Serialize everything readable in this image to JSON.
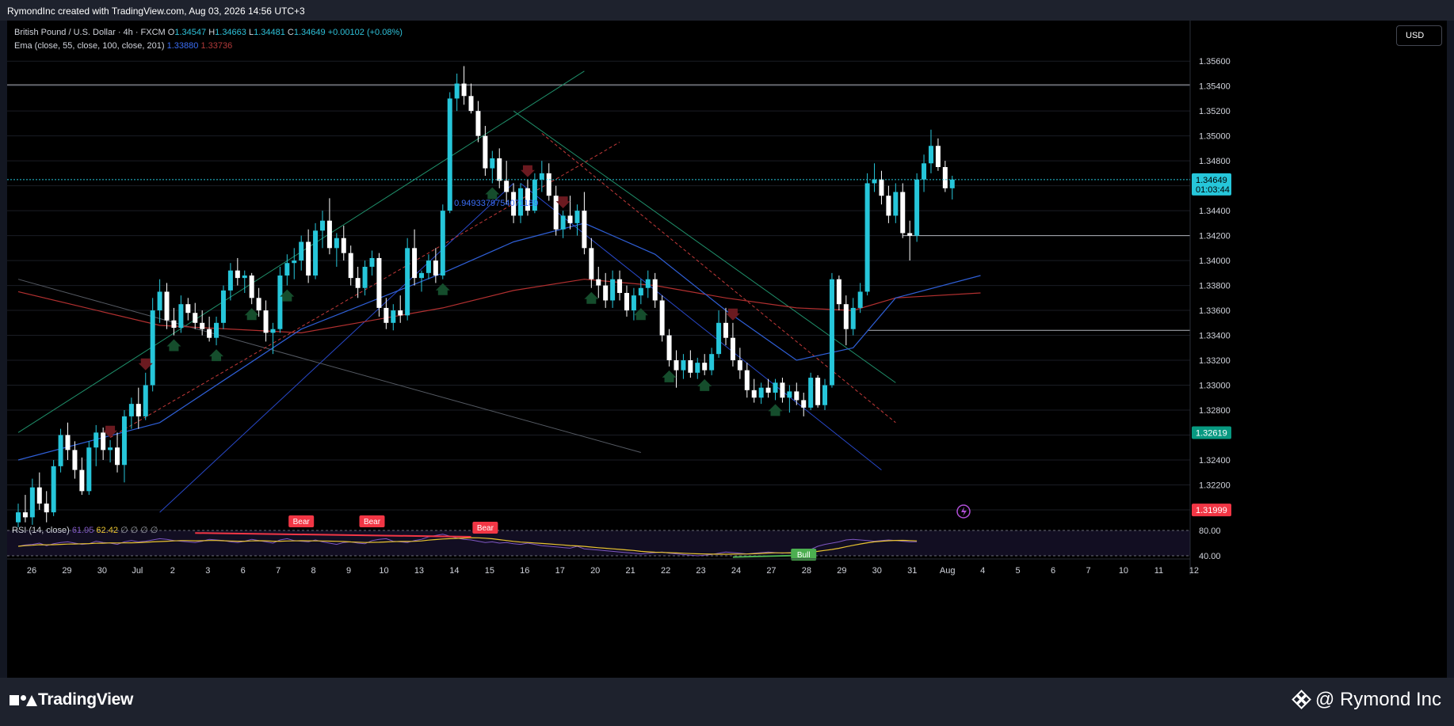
{
  "header": {
    "credit": "RymondInc created with TradingView.com, Aug 03, 2026 14:56 UTC+3"
  },
  "legend": {
    "symbol": "British Pound / U.S. Dollar · 4h · FXCM",
    "open_label": "O",
    "open": "1.34547",
    "high_label": "H",
    "high": "1.34663",
    "low_label": "L",
    "low": "1.34481",
    "close_label": "C",
    "close": "1.34649",
    "change": "+0.00102 (+0.08%)",
    "ema_label": "Ema (close, 55, close, 100, close, 201)",
    "ema_val1": "1.33880",
    "ema_val2": "1.33736"
  },
  "currency": "USD",
  "annotation_fib": "0.9493379754071189",
  "rsi_label": "RSI (14, close)",
  "rsi_val1": "61.95",
  "rsi_val2": "62.42",
  "rsi_zeros": "∅ ∅ ∅ ∅",
  "rsi_ticks": [
    "80.00",
    "40.00"
  ],
  "footer": {
    "brand": "TradingView",
    "watermark": "@ Rymond Inc"
  },
  "colors": {
    "up": "#26c6da",
    "down": "#ffffff",
    "ema_blue": "#2f5fd6",
    "ema_red": "#b23030",
    "current_badge": "#26c6da",
    "green_badge": "#089981",
    "red_badge": "#f23645",
    "bear_label": "#f23645",
    "bull_label": "#4caf50"
  },
  "chart_data": {
    "type": "candlestick",
    "symbol": "GBPUSD",
    "timeframe": "4h",
    "y_ticks": [
      "1.35600",
      "1.35400",
      "1.35200",
      "1.35000",
      "1.34800",
      "1.34600",
      "1.34400",
      "1.34200",
      "1.34000",
      "1.33800",
      "1.33600",
      "1.33400",
      "1.33200",
      "1.33000",
      "1.32800",
      "1.32600",
      "1.32400",
      "1.32200",
      "1.32000"
    ],
    "ylim": [
      1.3186,
      1.3576
    ],
    "x_ticks": [
      "26",
      "29",
      "30",
      "Jul",
      "2",
      "3",
      "6",
      "7",
      "8",
      "9",
      "10",
      "13",
      "14",
      "15",
      "16",
      "17",
      "20",
      "21",
      "22",
      "23",
      "24",
      "27",
      "28",
      "29",
      "30",
      "31",
      "Aug",
      "4",
      "5",
      "6",
      "7",
      "10",
      "11",
      "12"
    ],
    "price_badges": [
      {
        "value": "1.34649",
        "sub": "01:03:44",
        "price": 1.34649,
        "kind": "current"
      },
      {
        "value": "1.32619",
        "price": 1.32619,
        "kind": "green"
      },
      {
        "value": "1.31999",
        "price": 1.31999,
        "kind": "red"
      }
    ],
    "horizontal_levels": [
      1.3541,
      1.342,
      1.3344
    ],
    "candles": [
      {
        "o": 1.319,
        "h": 1.3205,
        "l": 1.3186,
        "c": 1.3198
      },
      {
        "o": 1.3198,
        "h": 1.3212,
        "l": 1.319,
        "c": 1.3194
      },
      {
        "o": 1.3194,
        "h": 1.3225,
        "l": 1.3188,
        "c": 1.3218
      },
      {
        "o": 1.3218,
        "h": 1.323,
        "l": 1.32,
        "c": 1.3205
      },
      {
        "o": 1.3205,
        "h": 1.3215,
        "l": 1.319,
        "c": 1.3198
      },
      {
        "o": 1.3198,
        "h": 1.324,
        "l": 1.3195,
        "c": 1.3235
      },
      {
        "o": 1.3235,
        "h": 1.3265,
        "l": 1.323,
        "c": 1.326
      },
      {
        "o": 1.326,
        "h": 1.327,
        "l": 1.324,
        "c": 1.3248
      },
      {
        "o": 1.3248,
        "h": 1.3255,
        "l": 1.3225,
        "c": 1.3232
      },
      {
        "o": 1.3232,
        "h": 1.3242,
        "l": 1.3212,
        "c": 1.3215
      },
      {
        "o": 1.3215,
        "h": 1.3255,
        "l": 1.3212,
        "c": 1.325
      },
      {
        "o": 1.325,
        "h": 1.3268,
        "l": 1.3235,
        "c": 1.3262
      },
      {
        "o": 1.3262,
        "h": 1.3266,
        "l": 1.324,
        "c": 1.3248
      },
      {
        "o": 1.3248,
        "h": 1.3256,
        "l": 1.3238,
        "c": 1.325
      },
      {
        "o": 1.325,
        "h": 1.3262,
        "l": 1.323,
        "c": 1.3236
      },
      {
        "o": 1.3236,
        "h": 1.328,
        "l": 1.3222,
        "c": 1.3275
      },
      {
        "o": 1.3275,
        "h": 1.329,
        "l": 1.3265,
        "c": 1.3285
      },
      {
        "o": 1.3285,
        "h": 1.3298,
        "l": 1.3265,
        "c": 1.3275
      },
      {
        "o": 1.3275,
        "h": 1.331,
        "l": 1.3272,
        "c": 1.33
      },
      {
        "o": 1.33,
        "h": 1.337,
        "l": 1.3295,
        "c": 1.336
      },
      {
        "o": 1.336,
        "h": 1.3385,
        "l": 1.335,
        "c": 1.3375
      },
      {
        "o": 1.3375,
        "h": 1.3382,
        "l": 1.3345,
        "c": 1.3352
      },
      {
        "o": 1.3352,
        "h": 1.3362,
        "l": 1.334,
        "c": 1.3346
      },
      {
        "o": 1.3346,
        "h": 1.3372,
        "l": 1.3342,
        "c": 1.3365
      },
      {
        "o": 1.3365,
        "h": 1.337,
        "l": 1.3352,
        "c": 1.3358
      },
      {
        "o": 1.3358,
        "h": 1.3366,
        "l": 1.3345,
        "c": 1.335
      },
      {
        "o": 1.335,
        "h": 1.336,
        "l": 1.334,
        "c": 1.3345
      },
      {
        "o": 1.3345,
        "h": 1.3355,
        "l": 1.3335,
        "c": 1.3338
      },
      {
        "o": 1.3338,
        "h": 1.3355,
        "l": 1.3332,
        "c": 1.335
      },
      {
        "o": 1.335,
        "h": 1.338,
        "l": 1.3345,
        "c": 1.3376
      },
      {
        "o": 1.3376,
        "h": 1.3398,
        "l": 1.3368,
        "c": 1.3392
      },
      {
        "o": 1.3392,
        "h": 1.3402,
        "l": 1.338,
        "c": 1.3386
      },
      {
        "o": 1.3386,
        "h": 1.3392,
        "l": 1.3374,
        "c": 1.3388
      },
      {
        "o": 1.3388,
        "h": 1.339,
        "l": 1.3365,
        "c": 1.337
      },
      {
        "o": 1.337,
        "h": 1.3378,
        "l": 1.3355,
        "c": 1.336
      },
      {
        "o": 1.336,
        "h": 1.3368,
        "l": 1.3335,
        "c": 1.3342
      },
      {
        "o": 1.3342,
        "h": 1.335,
        "l": 1.3325,
        "c": 1.3345
      },
      {
        "o": 1.3345,
        "h": 1.3395,
        "l": 1.3342,
        "c": 1.3388
      },
      {
        "o": 1.3388,
        "h": 1.3405,
        "l": 1.338,
        "c": 1.3398
      },
      {
        "o": 1.3398,
        "h": 1.341,
        "l": 1.3385,
        "c": 1.34
      },
      {
        "o": 1.34,
        "h": 1.342,
        "l": 1.3392,
        "c": 1.3415
      },
      {
        "o": 1.3415,
        "h": 1.3425,
        "l": 1.3382,
        "c": 1.3388
      },
      {
        "o": 1.3388,
        "h": 1.343,
        "l": 1.3385,
        "c": 1.3424
      },
      {
        "o": 1.3424,
        "h": 1.344,
        "l": 1.341,
        "c": 1.3432
      },
      {
        "o": 1.3432,
        "h": 1.345,
        "l": 1.3405,
        "c": 1.341
      },
      {
        "o": 1.341,
        "h": 1.3422,
        "l": 1.3395,
        "c": 1.3418
      },
      {
        "o": 1.3418,
        "h": 1.3428,
        "l": 1.34,
        "c": 1.3406
      },
      {
        "o": 1.3406,
        "h": 1.3412,
        "l": 1.338,
        "c": 1.3386
      },
      {
        "o": 1.3386,
        "h": 1.3395,
        "l": 1.337,
        "c": 1.3378
      },
      {
        "o": 1.3378,
        "h": 1.34,
        "l": 1.3372,
        "c": 1.3395
      },
      {
        "o": 1.3395,
        "h": 1.3408,
        "l": 1.3388,
        "c": 1.3402
      },
      {
        "o": 1.3402,
        "h": 1.3406,
        "l": 1.3355,
        "c": 1.3362
      },
      {
        "o": 1.3362,
        "h": 1.337,
        "l": 1.3345,
        "c": 1.335
      },
      {
        "o": 1.335,
        "h": 1.3365,
        "l": 1.3344,
        "c": 1.336
      },
      {
        "o": 1.336,
        "h": 1.3372,
        "l": 1.335,
        "c": 1.3356
      },
      {
        "o": 1.3356,
        "h": 1.3418,
        "l": 1.3352,
        "c": 1.341
      },
      {
        "o": 1.341,
        "h": 1.3425,
        "l": 1.338,
        "c": 1.3386
      },
      {
        "o": 1.3386,
        "h": 1.3392,
        "l": 1.3375,
        "c": 1.339
      },
      {
        "o": 1.339,
        "h": 1.3405,
        "l": 1.3385,
        "c": 1.34
      },
      {
        "o": 1.34,
        "h": 1.341,
        "l": 1.3382,
        "c": 1.3388
      },
      {
        "o": 1.3388,
        "h": 1.3445,
        "l": 1.3385,
        "c": 1.344
      },
      {
        "o": 1.344,
        "h": 1.3535,
        "l": 1.3438,
        "c": 1.353
      },
      {
        "o": 1.353,
        "h": 1.355,
        "l": 1.352,
        "c": 1.3542
      },
      {
        "o": 1.3542,
        "h": 1.3556,
        "l": 1.3525,
        "c": 1.3532
      },
      {
        "o": 1.3532,
        "h": 1.3542,
        "l": 1.3518,
        "c": 1.352
      },
      {
        "o": 1.352,
        "h": 1.3528,
        "l": 1.3495,
        "c": 1.35
      },
      {
        "o": 1.35,
        "h": 1.3508,
        "l": 1.3468,
        "c": 1.3474
      },
      {
        "o": 1.3474,
        "h": 1.3488,
        "l": 1.3462,
        "c": 1.3482
      },
      {
        "o": 1.3482,
        "h": 1.349,
        "l": 1.3458,
        "c": 1.3464
      },
      {
        "o": 1.3464,
        "h": 1.348,
        "l": 1.3445,
        "c": 1.3455
      },
      {
        "o": 1.3455,
        "h": 1.3462,
        "l": 1.343,
        "c": 1.3436
      },
      {
        "o": 1.3436,
        "h": 1.3462,
        "l": 1.343,
        "c": 1.3458
      },
      {
        "o": 1.3458,
        "h": 1.3465,
        "l": 1.3436,
        "c": 1.344
      },
      {
        "o": 1.344,
        "h": 1.347,
        "l": 1.3438,
        "c": 1.3465
      },
      {
        "o": 1.3465,
        "h": 1.348,
        "l": 1.3455,
        "c": 1.347
      },
      {
        "o": 1.347,
        "h": 1.3478,
        "l": 1.3448,
        "c": 1.3452
      },
      {
        "o": 1.3452,
        "h": 1.346,
        "l": 1.342,
        "c": 1.3425
      },
      {
        "o": 1.3425,
        "h": 1.344,
        "l": 1.3418,
        "c": 1.3436
      },
      {
        "o": 1.3436,
        "h": 1.3452,
        "l": 1.3425,
        "c": 1.343
      },
      {
        "o": 1.343,
        "h": 1.3445,
        "l": 1.342,
        "c": 1.344
      },
      {
        "o": 1.344,
        "h": 1.3455,
        "l": 1.3405,
        "c": 1.341
      },
      {
        "o": 1.341,
        "h": 1.3418,
        "l": 1.3378,
        "c": 1.3385
      },
      {
        "o": 1.3385,
        "h": 1.3395,
        "l": 1.337,
        "c": 1.338
      },
      {
        "o": 1.338,
        "h": 1.339,
        "l": 1.3362,
        "c": 1.3368
      },
      {
        "o": 1.3368,
        "h": 1.3392,
        "l": 1.3362,
        "c": 1.3385
      },
      {
        "o": 1.3385,
        "h": 1.3392,
        "l": 1.3368,
        "c": 1.3374
      },
      {
        "o": 1.3374,
        "h": 1.338,
        "l": 1.3355,
        "c": 1.336
      },
      {
        "o": 1.336,
        "h": 1.3378,
        "l": 1.3352,
        "c": 1.3372
      },
      {
        "o": 1.3372,
        "h": 1.3385,
        "l": 1.3365,
        "c": 1.3378
      },
      {
        "o": 1.3378,
        "h": 1.3392,
        "l": 1.337,
        "c": 1.3385
      },
      {
        "o": 1.3385,
        "h": 1.339,
        "l": 1.3362,
        "c": 1.3368
      },
      {
        "o": 1.3368,
        "h": 1.3372,
        "l": 1.3335,
        "c": 1.334
      },
      {
        "o": 1.334,
        "h": 1.3345,
        "l": 1.3315,
        "c": 1.332
      },
      {
        "o": 1.332,
        "h": 1.3328,
        "l": 1.3298,
        "c": 1.3312
      },
      {
        "o": 1.3312,
        "h": 1.3325,
        "l": 1.3305,
        "c": 1.332
      },
      {
        "o": 1.332,
        "h": 1.3328,
        "l": 1.3306,
        "c": 1.331
      },
      {
        "o": 1.331,
        "h": 1.3322,
        "l": 1.3305,
        "c": 1.3318
      },
      {
        "o": 1.3318,
        "h": 1.3325,
        "l": 1.3308,
        "c": 1.3312
      },
      {
        "o": 1.3312,
        "h": 1.333,
        "l": 1.3308,
        "c": 1.3325
      },
      {
        "o": 1.3325,
        "h": 1.336,
        "l": 1.3322,
        "c": 1.335
      },
      {
        "o": 1.335,
        "h": 1.3362,
        "l": 1.3332,
        "c": 1.3338
      },
      {
        "o": 1.3338,
        "h": 1.335,
        "l": 1.3315,
        "c": 1.332
      },
      {
        "o": 1.332,
        "h": 1.333,
        "l": 1.3305,
        "c": 1.3312
      },
      {
        "o": 1.3312,
        "h": 1.3318,
        "l": 1.329,
        "c": 1.3296
      },
      {
        "o": 1.3296,
        "h": 1.3305,
        "l": 1.3286,
        "c": 1.329
      },
      {
        "o": 1.329,
        "h": 1.3302,
        "l": 1.3285,
        "c": 1.3298
      },
      {
        "o": 1.3298,
        "h": 1.3305,
        "l": 1.329,
        "c": 1.3294
      },
      {
        "o": 1.3294,
        "h": 1.3305,
        "l": 1.3288,
        "c": 1.3302
      },
      {
        "o": 1.3302,
        "h": 1.3306,
        "l": 1.3286,
        "c": 1.329
      },
      {
        "o": 1.329,
        "h": 1.33,
        "l": 1.3278,
        "c": 1.3295
      },
      {
        "o": 1.3295,
        "h": 1.3302,
        "l": 1.3284,
        "c": 1.3288
      },
      {
        "o": 1.3288,
        "h": 1.3294,
        "l": 1.3275,
        "c": 1.3282
      },
      {
        "o": 1.3282,
        "h": 1.331,
        "l": 1.328,
        "c": 1.3306
      },
      {
        "o": 1.3306,
        "h": 1.3308,
        "l": 1.3282,
        "c": 1.3284
      },
      {
        "o": 1.3284,
        "h": 1.3305,
        "l": 1.328,
        "c": 1.33
      },
      {
        "o": 1.33,
        "h": 1.339,
        "l": 1.3298,
        "c": 1.3385
      },
      {
        "o": 1.3385,
        "h": 1.3388,
        "l": 1.336,
        "c": 1.3365
      },
      {
        "o": 1.3365,
        "h": 1.3372,
        "l": 1.3332,
        "c": 1.3345
      },
      {
        "o": 1.3345,
        "h": 1.337,
        "l": 1.334,
        "c": 1.3362
      },
      {
        "o": 1.3362,
        "h": 1.3382,
        "l": 1.3358,
        "c": 1.3375
      },
      {
        "o": 1.3375,
        "h": 1.347,
        "l": 1.3372,
        "c": 1.3462
      },
      {
        "o": 1.3462,
        "h": 1.3478,
        "l": 1.3455,
        "c": 1.3465
      },
      {
        "o": 1.3465,
        "h": 1.3472,
        "l": 1.3445,
        "c": 1.3452
      },
      {
        "o": 1.3452,
        "h": 1.346,
        "l": 1.343,
        "c": 1.3436
      },
      {
        "o": 1.3436,
        "h": 1.3462,
        "l": 1.343,
        "c": 1.3455
      },
      {
        "o": 1.3455,
        "h": 1.3462,
        "l": 1.3418,
        "c": 1.3422
      },
      {
        "o": 1.3422,
        "h": 1.3432,
        "l": 1.34,
        "c": 1.342
      },
      {
        "o": 1.342,
        "h": 1.347,
        "l": 1.3415,
        "c": 1.3465
      },
      {
        "o": 1.3465,
        "h": 1.3485,
        "l": 1.3455,
        "c": 1.3478
      },
      {
        "o": 1.3478,
        "h": 1.3505,
        "l": 1.347,
        "c": 1.3492
      },
      {
        "o": 1.3492,
        "h": 1.3498,
        "l": 1.3472,
        "c": 1.3475
      },
      {
        "o": 1.3475,
        "h": 1.348,
        "l": 1.3455,
        "c": 1.3458
      },
      {
        "o": 1.3458,
        "h": 1.3468,
        "l": 1.3449,
        "c": 1.3465
      }
    ],
    "ema_blue": [
      [
        0,
        1.324
      ],
      [
        20,
        1.327
      ],
      [
        40,
        1.3345
      ],
      [
        60,
        1.339
      ],
      [
        70,
        1.3415
      ],
      [
        80,
        1.343
      ],
      [
        90,
        1.3405
      ],
      [
        100,
        1.336
      ],
      [
        110,
        1.332
      ],
      [
        118,
        1.333
      ],
      [
        124,
        1.337
      ],
      [
        136,
        1.3388
      ]
    ],
    "ema_red": [
      [
        0,
        1.3375
      ],
      [
        20,
        1.3348
      ],
      [
        40,
        1.3342
      ],
      [
        60,
        1.3362
      ],
      [
        70,
        1.3376
      ],
      [
        80,
        1.3385
      ],
      [
        90,
        1.338
      ],
      [
        100,
        1.337
      ],
      [
        110,
        1.3362
      ],
      [
        118,
        1.336
      ],
      [
        124,
        1.337
      ],
      [
        136,
        1.3374
      ]
    ],
    "rsi": {
      "ticks": [
        80,
        40
      ],
      "values": [
        55,
        57,
        58,
        60,
        56,
        59,
        61,
        62,
        60,
        58,
        59,
        63,
        61,
        60,
        58,
        62,
        64,
        62,
        63,
        65,
        67,
        66,
        64,
        63,
        62,
        61,
        63,
        66,
        65,
        64,
        62,
        61,
        63,
        66,
        64,
        62,
        60,
        65,
        67,
        64,
        63,
        62,
        65,
        62,
        60,
        58,
        61,
        62,
        60,
        59,
        64,
        66,
        67,
        63,
        62,
        61,
        64,
        66,
        70,
        72,
        74,
        71,
        68,
        66,
        65,
        63,
        61,
        62,
        60,
        61,
        59,
        58,
        60,
        58,
        56,
        55,
        54,
        53,
        52,
        55,
        51,
        50,
        49,
        48,
        47,
        46,
        45,
        44,
        43,
        44,
        45,
        46,
        44,
        43,
        42,
        41,
        40,
        41,
        42,
        44,
        46,
        45,
        44,
        43,
        44,
        45,
        46,
        45,
        44,
        45,
        46,
        47,
        50,
        55,
        58,
        60,
        62,
        65,
        66,
        65,
        64,
        63,
        64,
        65,
        64,
        63,
        62,
        62
      ]
    },
    "labels": [
      {
        "text": "Bear",
        "kind": "bear"
      },
      {
        "text": "Bear",
        "kind": "bear"
      },
      {
        "text": "Bear",
        "kind": "bear"
      },
      {
        "text": "Bull",
        "kind": "bull"
      }
    ]
  }
}
